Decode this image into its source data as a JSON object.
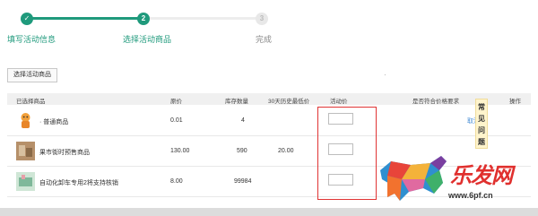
{
  "steps": [
    {
      "label": "填写活动信息",
      "marker": "check-icon",
      "state": "done"
    },
    {
      "label": "选择活动商品",
      "marker": "2",
      "state": "current"
    },
    {
      "label": "完成",
      "marker": "3",
      "state": "todo"
    }
  ],
  "select_button": "选择活动商品",
  "dot_mark": "·",
  "table": {
    "headers": [
      "已选择商品",
      "原价",
      "库存数量",
      "30天历史最低价",
      "活动价",
      "是否符合价格要求",
      "操作"
    ],
    "rows": [
      {
        "name": "· 普通商品",
        "price": "0.01",
        "stock": "4",
        "low": ""
      },
      {
        "name": "果市街时预售商品",
        "price": "130.00",
        "stock": "590",
        "low": "20.00"
      },
      {
        "name": "自动化卸车专用2将支持核销",
        "price": "8.00",
        "stock": "99984",
        "low": ""
      }
    ],
    "op_link": "取消"
  },
  "faq_label": "常见问题",
  "watermark": {
    "text": "乐发网",
    "url": "www.6pf.cn"
  },
  "colors": {
    "accent": "#1f9a7c",
    "highlight": "#e03434",
    "link": "#4a8fd6"
  }
}
